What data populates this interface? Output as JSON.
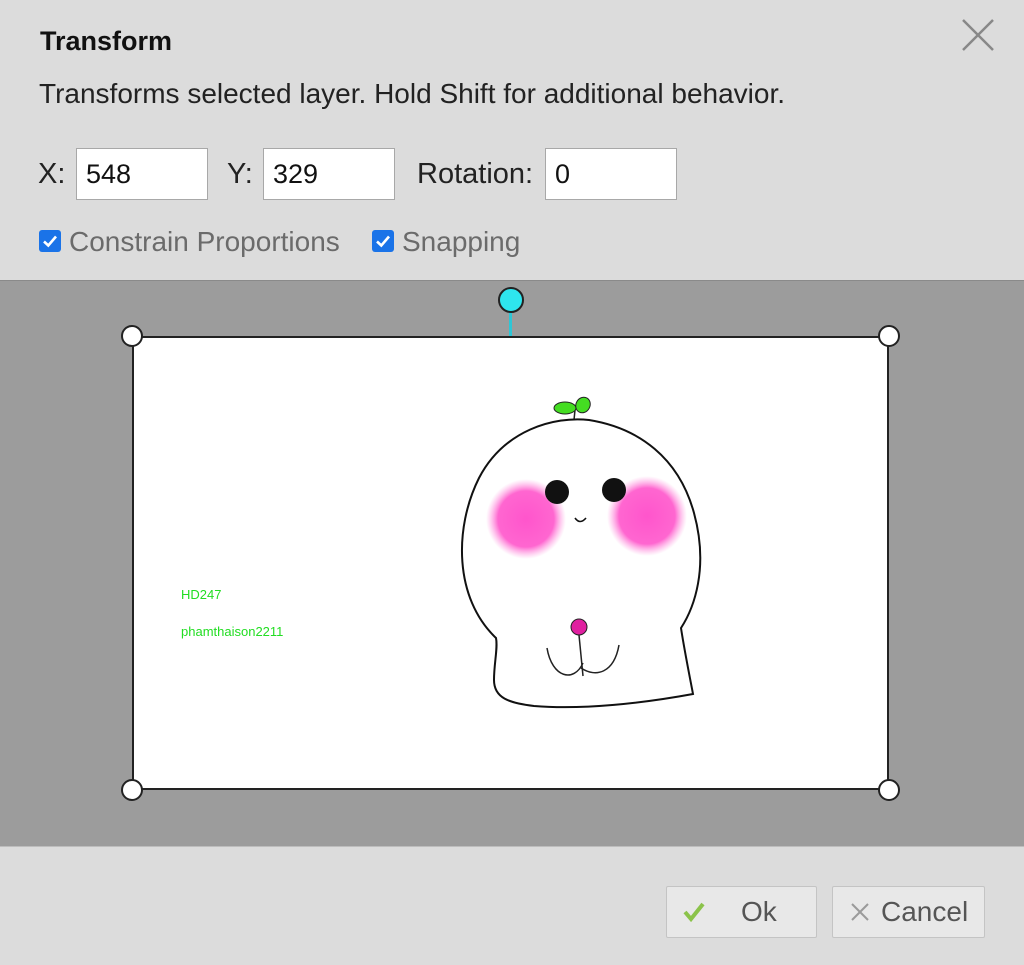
{
  "dialog": {
    "title": "Transform",
    "description": "Transforms selected layer. Hold Shift for additional behavior."
  },
  "fields": {
    "x_label": "X:",
    "x_value": "548",
    "y_label": "Y:",
    "y_value": "329",
    "rotation_label": "Rotation:",
    "rotation_value": "0"
  },
  "options": {
    "constrain_label": "Constrain Proportions",
    "constrain_checked": true,
    "snapping_label": "Snapping",
    "snapping_checked": true
  },
  "layer_content": {
    "text_1": "HD247",
    "text_2": "phamthaison2211"
  },
  "buttons": {
    "ok_label": "Ok",
    "cancel_label": "Cancel"
  },
  "colors": {
    "rotation_handle": "#2ee6ee",
    "checkbox_accent": "#1a73e8",
    "ok_check": "#8bc34a",
    "layer_text": "#22dd22",
    "blush": "#ff55cc"
  }
}
